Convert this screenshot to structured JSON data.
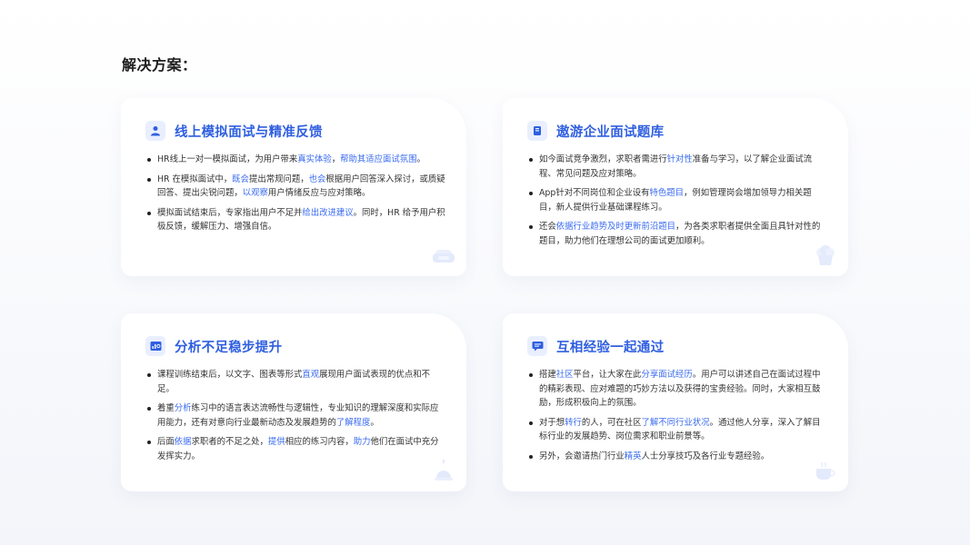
{
  "page": {
    "title": "解决方案："
  },
  "colors": {
    "accent": "#2f5fe0",
    "highlight": "#3a6bf0",
    "icon_bg": "#e9efff"
  },
  "cards": [
    {
      "title": "线上模拟面试与精准反馈",
      "icon": "user-icon",
      "deco_icon": "sofa-icon",
      "items": [
        {
          "segments": [
            {
              "t": "HR线上一对一模拟面试，为用户带来"
            },
            {
              "t": "真实体验",
              "hl": true
            },
            {
              "t": "，"
            },
            {
              "t": "帮助其适应面试氛围",
              "hl": true
            },
            {
              "t": "。"
            }
          ]
        },
        {
          "segments": [
            {
              "t": "HR 在模拟面试中，"
            },
            {
              "t": "既会",
              "hl": true
            },
            {
              "t": "提出常规问题，"
            },
            {
              "t": "也会",
              "hl": true
            },
            {
              "t": "根据用户回答深入探讨，或质疑回答、提出尖锐问题，"
            },
            {
              "t": "以观察",
              "hl": true
            },
            {
              "t": "用户情绪反应与应对策略。"
            }
          ]
        },
        {
          "segments": [
            {
              "t": "模拟面试结束后，专家指出用户不足并"
            },
            {
              "t": "给出改进建议",
              "hl": true
            },
            {
              "t": "。同时，HR 给予用户积极反馈，缓解压力、增强自信。"
            }
          ]
        }
      ]
    },
    {
      "title": "遨游企业面试题库",
      "icon": "book-icon",
      "deco_icon": "cupcake-icon",
      "items": [
        {
          "segments": [
            {
              "t": "如今面试竞争激烈，求职者需进行"
            },
            {
              "t": "针对性",
              "hl": true
            },
            {
              "t": "准备与学习，以了解企业面试流程、常见问题及应对策略。"
            }
          ]
        },
        {
          "segments": [
            {
              "t": "App针对不同岗位和企业设有"
            },
            {
              "t": "特色题目",
              "hl": true
            },
            {
              "t": "，例如管理岗会增加领导力相关题目，新人提供行业基础课程练习。"
            }
          ]
        },
        {
          "segments": [
            {
              "t": "还会"
            },
            {
              "t": "依据行业趋势及时更新前沿题目",
              "hl": true
            },
            {
              "t": "，为各类求职者提供全面且具针对性的题目，助力他们在理想公司的面试更加顺利。"
            }
          ]
        }
      ]
    },
    {
      "title": "分析不足稳步提升",
      "icon": "chart-board-icon",
      "deco_icon": "alarm-bell-icon",
      "items": [
        {
          "segments": [
            {
              "t": "课程训练结束后，以文字、图表等形式"
            },
            {
              "t": "直观",
              "hl": true
            },
            {
              "t": "展现用户面试表现的优点和不足。"
            }
          ]
        },
        {
          "segments": [
            {
              "t": "着重"
            },
            {
              "t": "分析",
              "hl": true
            },
            {
              "t": "练习中的语言表达流畅性与逻辑性，专业知识的理解深度和实际应用能力，还有对意向行业最新动态及发展趋势的"
            },
            {
              "t": "了解程度",
              "hl": true
            },
            {
              "t": "。"
            }
          ]
        },
        {
          "segments": [
            {
              "t": "后面"
            },
            {
              "t": "依据",
              "hl": true
            },
            {
              "t": "求职者的不足之处，"
            },
            {
              "t": "提供",
              "hl": true
            },
            {
              "t": "相应的练习内容，"
            },
            {
              "t": "助力",
              "hl": true
            },
            {
              "t": "他们在面试中充分发挥实力。"
            }
          ]
        }
      ]
    },
    {
      "title": "互相经验一起通过",
      "icon": "chat-icon",
      "deco_icon": "coffee-cup-icon",
      "items": [
        {
          "segments": [
            {
              "t": "搭建"
            },
            {
              "t": "社区",
              "hl": true
            },
            {
              "t": "平台，让大家在此"
            },
            {
              "t": "分享面试经历",
              "hl": true
            },
            {
              "t": "。用户可以讲述自己在面试过程中的精彩表现、应对难题的巧妙方法以及获得的宝贵经验。同时，大家相互鼓励，形成积极向上的氛围。"
            }
          ]
        },
        {
          "segments": [
            {
              "t": "对于想"
            },
            {
              "t": "转行",
              "hl": true
            },
            {
              "t": "的人，可在社区"
            },
            {
              "t": "了解不同行业状况",
              "hl": true
            },
            {
              "t": "。通过他人分享，深入了解目标行业的发展趋势、岗位需求和职业前景等。"
            }
          ]
        },
        {
          "segments": [
            {
              "t": "另外，会邀请热门行业"
            },
            {
              "t": "精英",
              "hl": true
            },
            {
              "t": "人士分享技巧及各行业专题经验。"
            }
          ]
        }
      ]
    }
  ]
}
